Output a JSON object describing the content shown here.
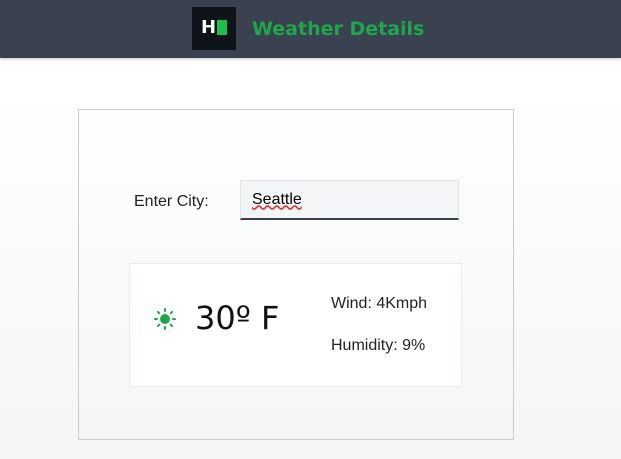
{
  "header": {
    "logo_letter": "H",
    "title": "Weather Details",
    "background_color": "#3a424f",
    "title_color": "#1ea64a",
    "logo_accent_color": "#1fbd4c"
  },
  "form": {
    "city_label": "Enter City:",
    "city_value": "Seattle"
  },
  "weather": {
    "icon": "sun-icon",
    "icon_color": "#1ea64a",
    "temperature": "30º F",
    "wind": "Wind: 4Kmph",
    "humidity": "Humidity: 9%"
  }
}
